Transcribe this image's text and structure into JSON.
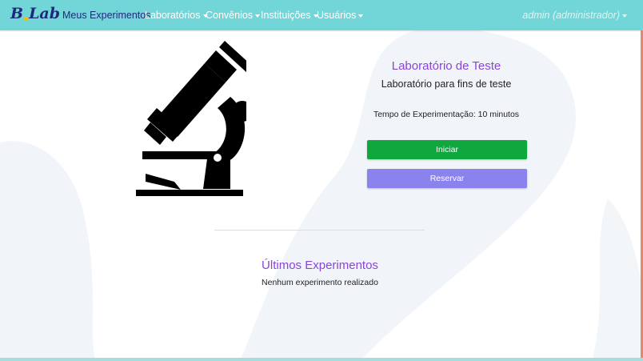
{
  "brand": {
    "logo_text_b": "B",
    "logo_text_lab": "Lab"
  },
  "nav": {
    "items": [
      {
        "label": "Meus Experimentos",
        "active": true,
        "dropdown": false
      },
      {
        "label": "Laboratórios",
        "active": false,
        "dropdown": true
      },
      {
        "label": "Convênios",
        "active": false,
        "dropdown": true
      },
      {
        "label": "Instituições",
        "active": false,
        "dropdown": true
      },
      {
        "label": "Usuários",
        "active": false,
        "dropdown": true
      }
    ],
    "user": "admin (administrador)"
  },
  "lab": {
    "title": "Laboratório de Teste",
    "description": "Laboratório para fins de teste",
    "time_label": "Tempo de Experimentação: 10 minutos",
    "image_icon": "microscope-icon"
  },
  "actions": {
    "start_label": "Iniciar",
    "reserve_label": "Reservar"
  },
  "recent": {
    "title": "Últimos Experimentos",
    "empty_text": "Nenhum experimento realizado"
  },
  "colors": {
    "navbar": "#72d6d8",
    "accent_purple": "#8a45d6",
    "start_green": "#0ea83f",
    "reserve_purple": "#8b83ed",
    "blob": "#f2f6fa"
  }
}
